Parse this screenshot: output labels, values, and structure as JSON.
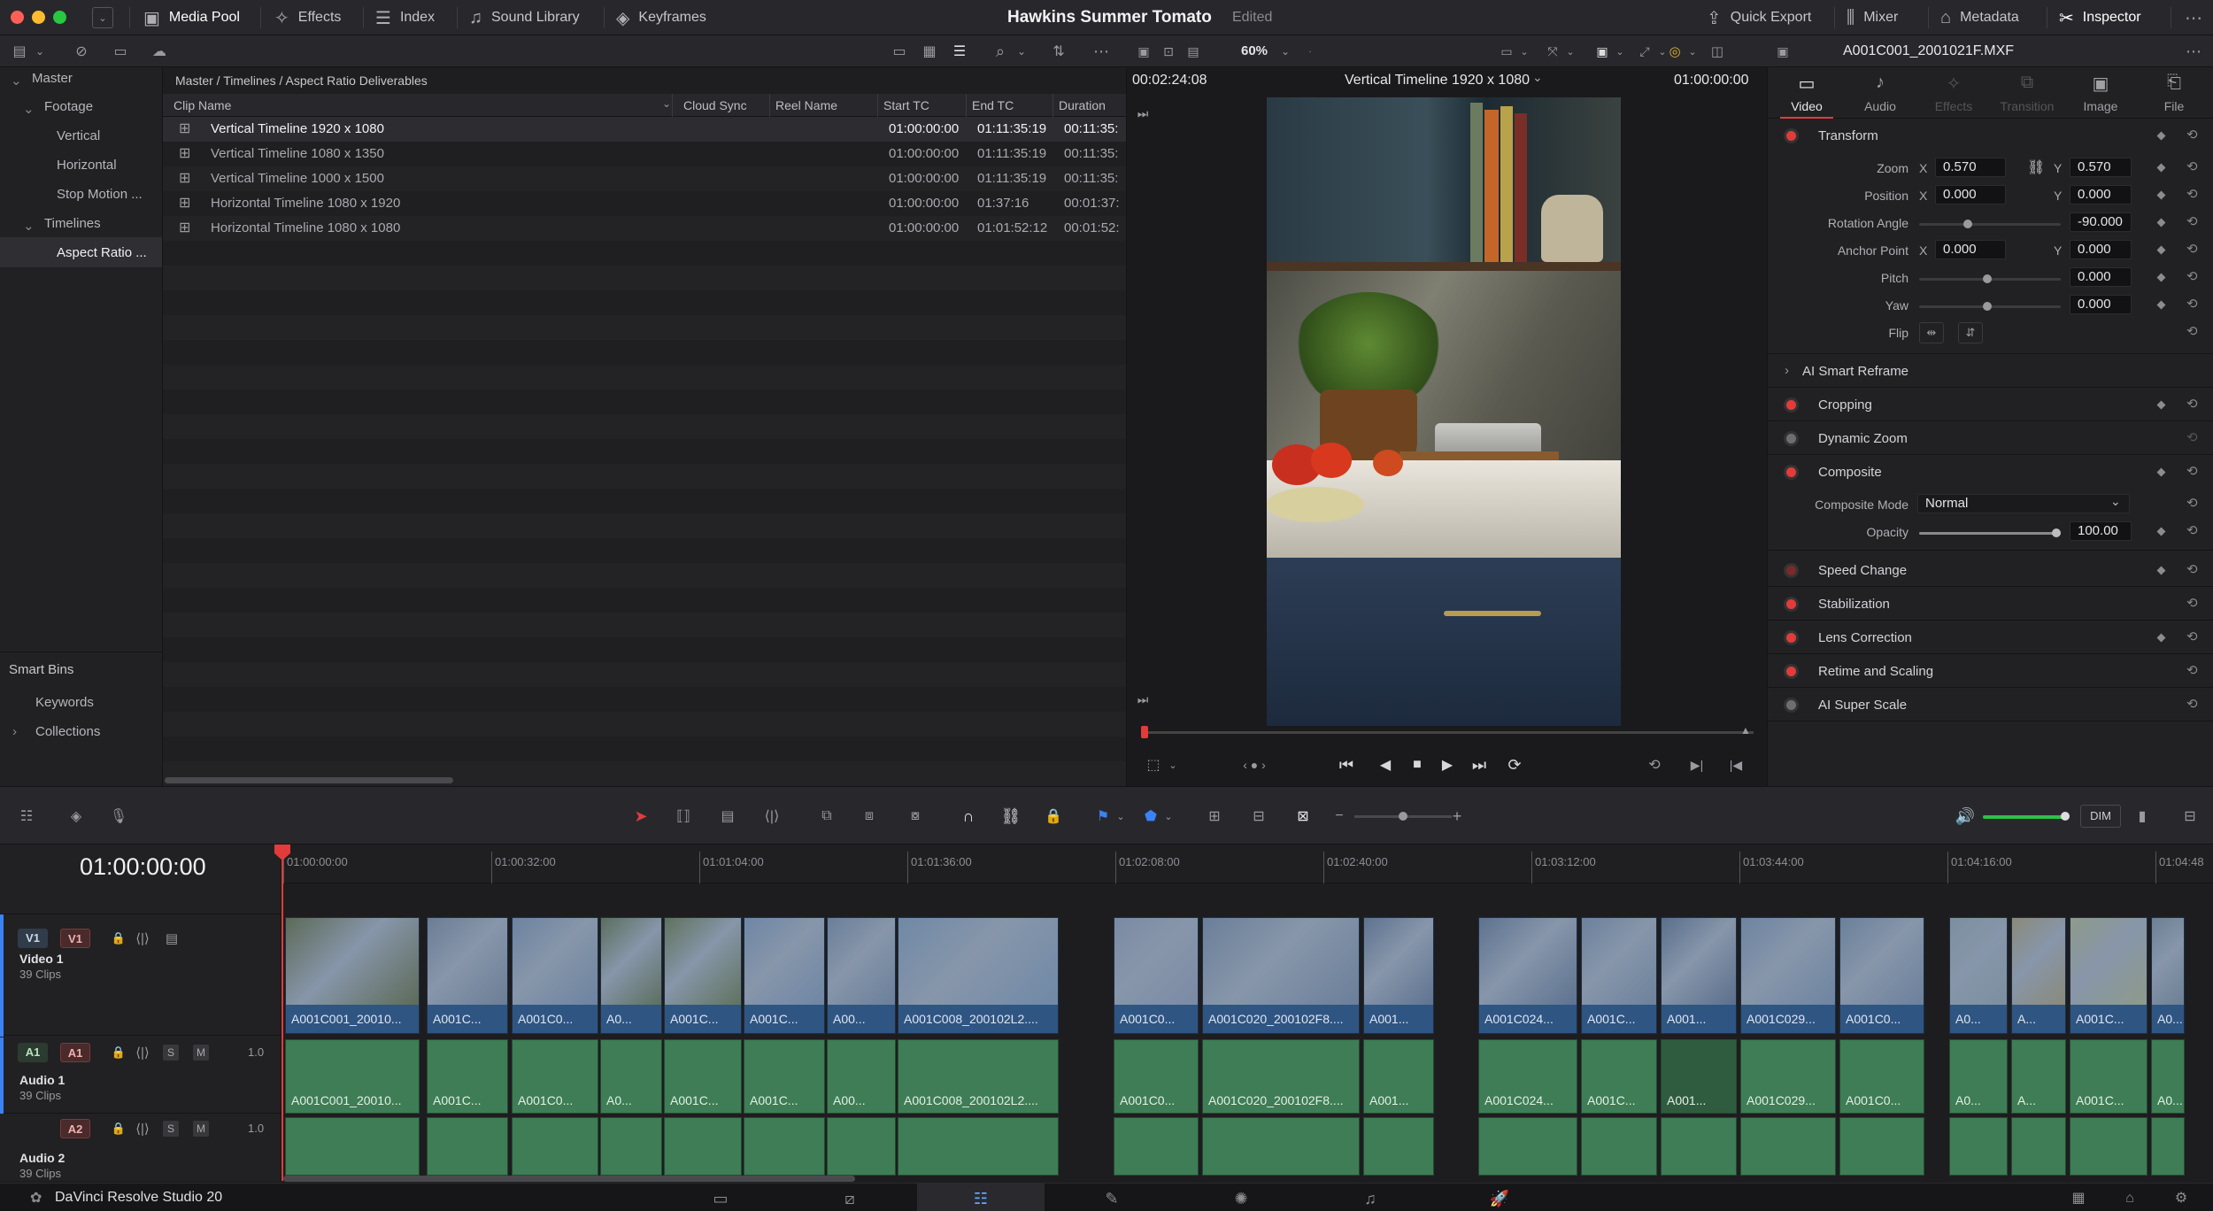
{
  "app": {
    "name": "DaVinci Resolve Studio 20"
  },
  "project": {
    "title": "Hawkins Summer Tomato",
    "status": "Edited"
  },
  "topbar": {
    "media_pool": "Media Pool",
    "effects": "Effects",
    "index": "Index",
    "sound_library": "Sound Library",
    "keyframes": "Keyframes",
    "quick_export": "Quick Export",
    "mixer": "Mixer",
    "metadata": "Metadata",
    "inspector": "Inspector"
  },
  "bins": {
    "master": "Master",
    "footage": "Footage",
    "vertical": "Vertical",
    "horizontal": "Horizontal",
    "stop_motion": "Stop Motion ...",
    "timelines": "Timelines",
    "aspect_ratio": "Aspect Ratio ...",
    "smart_bins": "Smart Bins",
    "keywords": "Keywords",
    "collections": "Collections"
  },
  "media_pool": {
    "breadcrumb": "Master / Timelines / Aspect Ratio Deliverables",
    "columns": [
      "Clip Name",
      "Cloud Sync",
      "Reel Name",
      "Start TC",
      "End TC",
      "Duration"
    ],
    "rows": [
      {
        "name": "Vertical Timeline 1920 x 1080",
        "start": "01:00:00:00",
        "end": "01:11:35:19",
        "duration": "00:11:35:"
      },
      {
        "name": "Vertical Timeline 1080 x 1350",
        "start": "01:00:00:00",
        "end": "01:11:35:19",
        "duration": "00:11:35:"
      },
      {
        "name": "Vertical Timeline 1000 x 1500",
        "start": "01:00:00:00",
        "end": "01:11:35:19",
        "duration": "00:11:35:"
      },
      {
        "name": "Horizontal Timeline 1080 x 1920",
        "start": "01:00:00:00",
        "end": "01:37:16",
        "duration": "00:01:37:"
      },
      {
        "name": "Horizontal Timeline 1080 x 1080",
        "start": "01:00:00:00",
        "end": "01:01:52:12",
        "duration": "00:01:52:"
      }
    ]
  },
  "viewer": {
    "zoom": "60%",
    "timecode_left": "00:02:24:08",
    "timeline_name": "Vertical Timeline 1920 x 1080",
    "timecode_right": "01:00:00:00"
  },
  "inspector": {
    "clip_name": "A001C001_2001021F.MXF",
    "tabs": [
      "Video",
      "Audio",
      "Effects",
      "Transition",
      "Image",
      "File"
    ],
    "transform": "Transform",
    "zoom_label": "Zoom",
    "zoom_x": "0.570",
    "zoom_y": "0.570",
    "position_label": "Position",
    "position_x": "0.000",
    "position_y": "0.000",
    "rotation_label": "Rotation Angle",
    "rotation": "-90.000",
    "anchor_label": "Anchor Point",
    "anchor_x": "0.000",
    "anchor_y": "0.000",
    "pitch_label": "Pitch",
    "pitch": "0.000",
    "yaw_label": "Yaw",
    "yaw": "0.000",
    "flip_label": "Flip",
    "x": "X",
    "y": "Y",
    "ai_smart_reframe": "AI Smart Reframe",
    "cropping": "Cropping",
    "dynamic_zoom": "Dynamic Zoom",
    "composite": "Composite",
    "composite_mode_label": "Composite Mode",
    "composite_mode": "Normal",
    "opacity_label": "Opacity",
    "opacity": "100.00",
    "speed_change": "Speed Change",
    "stabilization": "Stabilization",
    "lens_correction": "Lens Correction",
    "retime_scaling": "Retime and Scaling",
    "ai_super_scale": "AI Super Scale"
  },
  "timeline": {
    "timecode": "01:00:00:00",
    "dim": "DIM",
    "ruler": [
      "01:00:00:00",
      "01:00:32:00",
      "01:01:04:00",
      "01:01:36:00",
      "01:02:08:00",
      "01:02:40:00",
      "01:03:12:00",
      "01:03:44:00",
      "01:04:16:00",
      "01:04:48"
    ],
    "video1": {
      "badge": "V1",
      "name": "Video 1",
      "clips": "39 Clips"
    },
    "audio1": {
      "badge": "A1",
      "name": "Audio 1",
      "clips": "39 Clips",
      "level": "1.0"
    },
    "audio2": {
      "badge": "A2",
      "name": "Audio 2",
      "clips": "39 Clips",
      "level": "1.0"
    },
    "s": "S",
    "m": "M",
    "clip_labels": [
      "A001C001_20010...",
      "A001C...",
      "A001C0...",
      "A0...",
      "A001C...",
      "A001C...",
      "A00...",
      "A001C008_200102L2....",
      "A001C0...",
      "A001C020_200102F8....",
      "A001...",
      "A001C024...",
      "A001C...",
      "A001...",
      "A001C029...",
      "A001C0...",
      "A0...",
      "A...",
      "A001C...",
      "A0..."
    ]
  },
  "colors": {
    "accent_red": "#e23b3b",
    "video_clip": "#3b5e87",
    "audio_clip": "#3e7d55"
  }
}
